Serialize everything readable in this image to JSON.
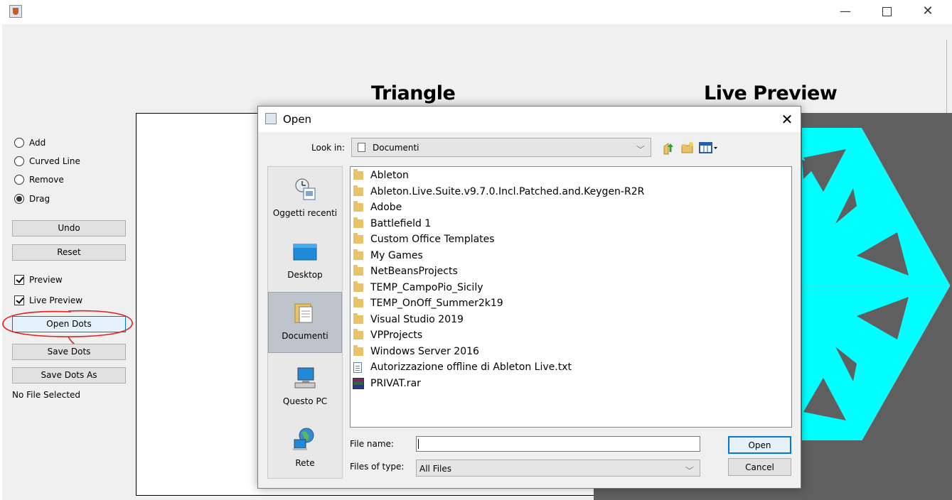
{
  "window": {
    "title": ""
  },
  "side_panel": {
    "modes": [
      {
        "label": "Add",
        "checked": false
      },
      {
        "label": "Curved Line",
        "checked": false
      },
      {
        "label": "Remove",
        "checked": false
      },
      {
        "label": "Drag",
        "checked": true
      }
    ],
    "undo_label": "Undo",
    "reset_label": "Reset",
    "preview_label": "Preview",
    "preview_checked": true,
    "live_preview_label": "Live Preview",
    "live_preview_checked": true,
    "open_dots_label": "Open Dots",
    "save_dots_label": "Save Dots",
    "save_dots_as_label": "Save Dots As",
    "status": "No File Selected"
  },
  "canvas": {
    "triangle_title": "Triangle",
    "live_preview_title": "Live Preview",
    "preview_fill_color": "#00ffff",
    "preview_bg_color": "#5f5f5f"
  },
  "dialog": {
    "title": "Open",
    "look_in_label": "Look in:",
    "look_in_value": "Documenti",
    "places": [
      {
        "label": "Oggetti recenti",
        "icon": "recent-items-icon"
      },
      {
        "label": "Desktop",
        "icon": "desktop-icon"
      },
      {
        "label": "Documenti",
        "icon": "documents-icon",
        "selected": true
      },
      {
        "label": "Questo PC",
        "icon": "computer-icon"
      },
      {
        "label": "Rete",
        "icon": "network-icon"
      }
    ],
    "files": [
      {
        "name": "Ableton",
        "type": "folder"
      },
      {
        "name": "Ableton.Live.Suite.v9.7.0.Incl.Patched.and.Keygen-R2R",
        "type": "folder"
      },
      {
        "name": "Adobe",
        "type": "folder"
      },
      {
        "name": "Battlefield 1",
        "type": "folder"
      },
      {
        "name": "Custom Office Templates",
        "type": "folder"
      },
      {
        "name": "My Games",
        "type": "folder"
      },
      {
        "name": "NetBeansProjects",
        "type": "folder"
      },
      {
        "name": "TEMP_CampoPio_Sicily",
        "type": "folder"
      },
      {
        "name": "TEMP_OnOff_Summer2k19",
        "type": "folder"
      },
      {
        "name": "Visual Studio 2019",
        "type": "folder"
      },
      {
        "name": "VPProjects",
        "type": "folder"
      },
      {
        "name": "Windows Server 2016",
        "type": "folder"
      },
      {
        "name": "Autorizzazione offline di Ableton Live.txt",
        "type": "text"
      },
      {
        "name": "PRIVAT.rar",
        "type": "archive"
      }
    ],
    "file_name_label": "File name:",
    "file_name_value": "",
    "files_of_type_label": "Files of type:",
    "files_of_type_value": "All Files",
    "open_label": "Open",
    "cancel_label": "Cancel"
  }
}
